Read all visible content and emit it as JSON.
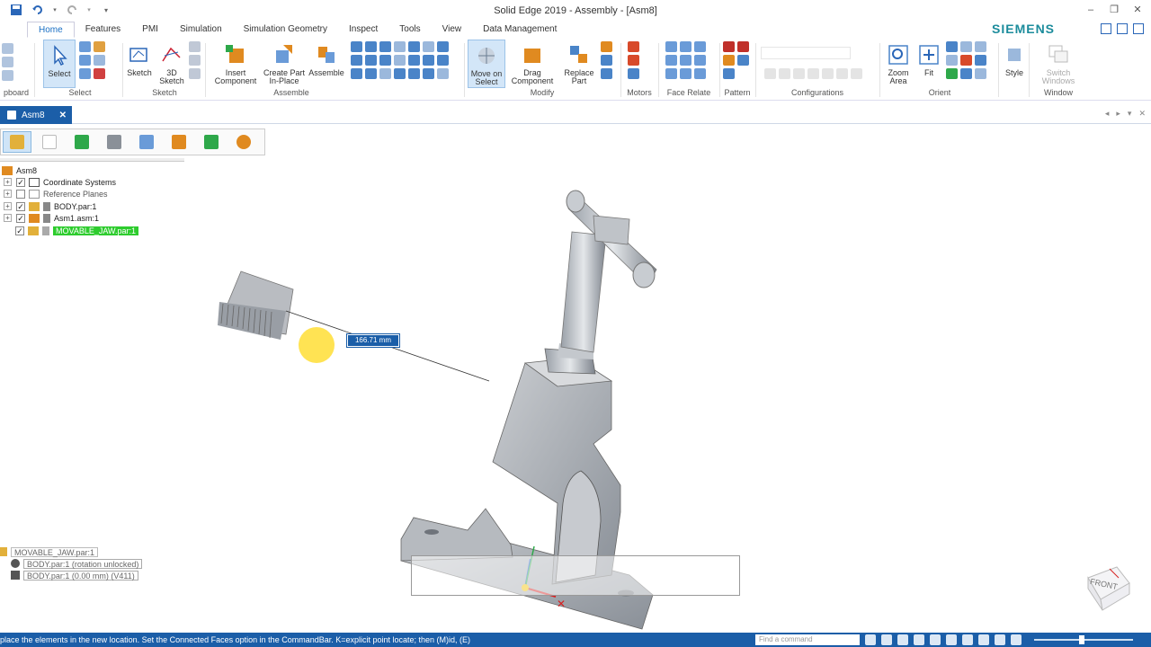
{
  "window": {
    "title": "Solid Edge 2019 - Assembly - [Asm8]",
    "brand": "SIEMENS"
  },
  "ribbon_tabs": [
    "Home",
    "Features",
    "PMI",
    "Simulation",
    "Simulation Geometry",
    "Inspect",
    "Tools",
    "View",
    "Data Management"
  ],
  "ribbon": {
    "clipboard_label": "pboard",
    "select": {
      "button": "Select",
      "group": "Select"
    },
    "sketch": {
      "sketch_btn": "Sketch",
      "sketch3d_line1": "3D",
      "sketch3d_line2": "Sketch",
      "group": "Sketch"
    },
    "assemble": {
      "insert_line1": "Insert",
      "insert_line2": "Component",
      "create_line1": "Create Part",
      "create_line2": "In-Place",
      "assemble_btn": "Assemble",
      "group": "Assemble"
    },
    "modify": {
      "move_line1": "Move on",
      "move_line2": "Select",
      "drag_line1": "Drag",
      "drag_line2": "Component",
      "replace_line1": "Replace",
      "replace_line2": "Part",
      "group": "Modify"
    },
    "motors": {
      "group": "Motors"
    },
    "face_relate": {
      "group": "Face Relate"
    },
    "pattern": {
      "group": "Pattern"
    },
    "configurations": {
      "group": "Configurations"
    },
    "orient": {
      "zoom_line1": "Zoom",
      "zoom_line2": "Area",
      "fit": "Fit",
      "group": "Orient"
    },
    "style": {
      "button": "Style"
    },
    "window": {
      "switch_line1": "Switch",
      "switch_line2": "Windows",
      "group": "Window"
    }
  },
  "document_tab": {
    "label": "Asm8"
  },
  "tree": {
    "root": "Asm8",
    "items": [
      {
        "label": "Coordinate Systems",
        "checked": true
      },
      {
        "label": "Reference Planes",
        "checked": false
      },
      {
        "label": "BODY.par:1",
        "checked": true
      },
      {
        "label": "Asm1.asm:1",
        "checked": true
      },
      {
        "label": "MOVABLE_JAW.par:1",
        "checked": true,
        "selected": true
      }
    ]
  },
  "relationships": {
    "part": "MOVABLE_JAW.par:1",
    "items": [
      "BODY.par:1  (rotation unlocked)",
      "BODY.par:1  (0.00 mm)  (V411)"
    ]
  },
  "viewport": {
    "measurement": "166.71 mm",
    "viewcube_label": "FRONT"
  },
  "statusbar": {
    "prompt": "place the elements in the new location.  Set the Connected Faces option in the CommandBar.  K=explicit point locate; then (M)id, (E)",
    "find_placeholder": "Find a command"
  },
  "colors": {
    "accent": "#1b5ea8",
    "selection": "#2ecc2e",
    "brand": "#1c8c9c"
  }
}
